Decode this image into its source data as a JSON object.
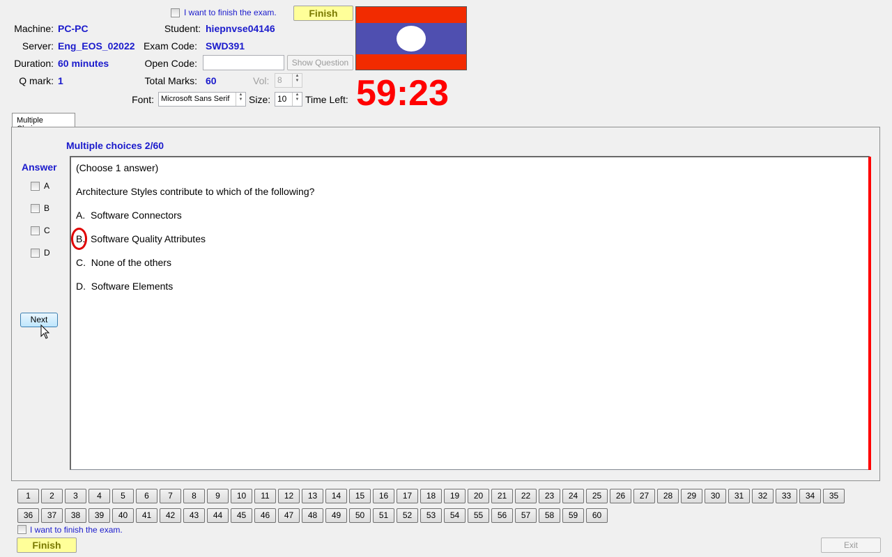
{
  "header": {
    "finish_check_label": "I want to finish the exam.",
    "finish_button": "Finish",
    "machine_label": "Machine:",
    "machine_value": "PC-PC",
    "server_label": "Server:",
    "server_value": "Eng_EOS_02022",
    "duration_label": "Duration:",
    "duration_value": "60 minutes",
    "qmark_label": "Q mark:",
    "qmark_value": "1",
    "student_label": "Student:",
    "student_value": "hiepnvse04146",
    "examcode_label": "Exam Code:",
    "examcode_value": "SWD391",
    "opencode_label": "Open Code:",
    "opencode_value": "",
    "show_question_button": "Show Question",
    "totalmarks_label": "Total Marks:",
    "totalmarks_value": "60",
    "vol_label": "Vol:",
    "vol_value": "8",
    "font_label": "Font:",
    "font_value": "Microsoft Sans Serif",
    "size_label": "Size:",
    "size_value": "10",
    "timeleft_label": "Time Left:",
    "timer": "59:23",
    "flag_colors": {
      "red": "#f22b00",
      "blue": "#4f4fb0",
      "white": "#ffffff"
    }
  },
  "tab": {
    "label": "Multiple Choices"
  },
  "question": {
    "heading": "Multiple choices 2/60",
    "instruction": "(Choose 1 answer)",
    "text": "Architecture Styles contribute to which of the following?",
    "options": [
      {
        "letter": "A.",
        "text": "Software Connectors"
      },
      {
        "letter": "B.",
        "text": "Software Quality Attributes"
      },
      {
        "letter": "C.",
        "text": "None of the others"
      },
      {
        "letter": "D.",
        "text": "Software Elements"
      }
    ]
  },
  "answer": {
    "title": "Answer",
    "choices": [
      "A",
      "B",
      "C",
      "D"
    ],
    "next_button": "Next"
  },
  "navigation": {
    "row1": [
      "1",
      "2",
      "3",
      "4",
      "5",
      "6",
      "7",
      "8",
      "9",
      "10",
      "11",
      "12",
      "13",
      "14",
      "15",
      "16",
      "17",
      "18",
      "19",
      "20",
      "21",
      "22",
      "23",
      "24",
      "25",
      "26",
      "27",
      "28",
      "29",
      "30",
      "31",
      "32",
      "33",
      "34",
      "35"
    ],
    "row2": [
      "36",
      "37",
      "38",
      "39",
      "40",
      "41",
      "42",
      "43",
      "44",
      "45",
      "46",
      "47",
      "48",
      "49",
      "50",
      "51",
      "52",
      "53",
      "54",
      "55",
      "56",
      "57",
      "58",
      "59",
      "60"
    ]
  },
  "footer": {
    "finish_check_label": "I want to finish the exam.",
    "finish_button": "Finish",
    "exit_button": "Exit"
  }
}
